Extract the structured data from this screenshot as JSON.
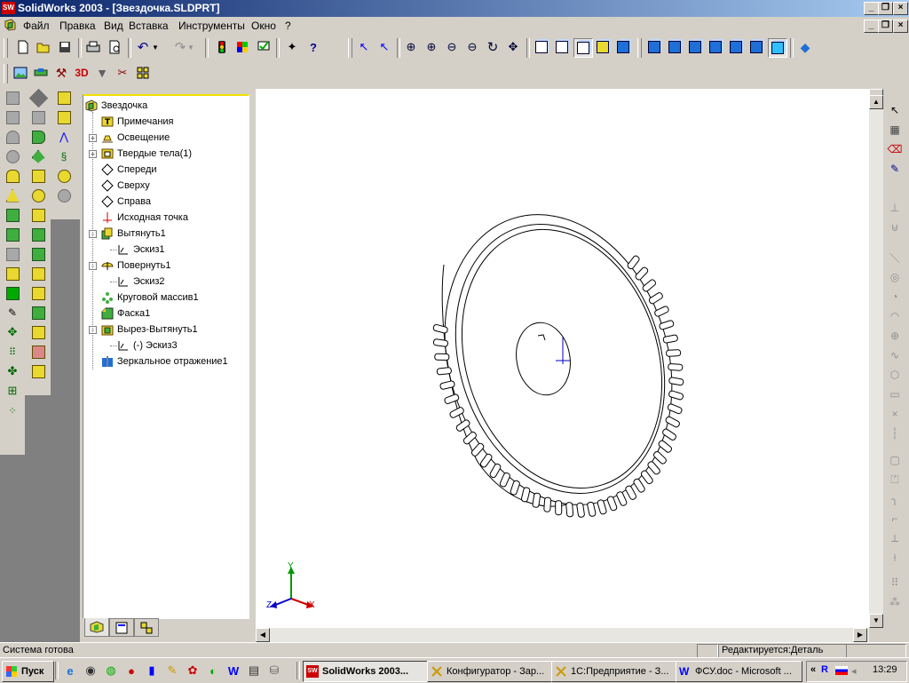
{
  "window": {
    "title": "SolidWorks 2003 - [Звездочка.SLDPRT]",
    "app_icon": "SW"
  },
  "menu": [
    "Файл",
    "Правка",
    "Вид",
    "Вставка",
    "Инструменты",
    "Окно",
    "?"
  ],
  "toolbar": {
    "label_3d": "3D"
  },
  "tree": {
    "root": "Звездочка",
    "items": [
      {
        "label": "Примечания",
        "icon": "annotations-icon"
      },
      {
        "label": "Освещение",
        "icon": "lighting-icon"
      },
      {
        "label": "Твердые тела(1)",
        "icon": "solid-bodies-icon"
      },
      {
        "label": "Спереди",
        "icon": "plane-icon"
      },
      {
        "label": "Сверху",
        "icon": "plane-icon"
      },
      {
        "label": "Справа",
        "icon": "plane-icon"
      },
      {
        "label": "Исходная точка",
        "icon": "origin-icon"
      },
      {
        "label": "Вытянуть1",
        "icon": "extrude-icon"
      },
      {
        "label": "Эскиз1",
        "icon": "sketch-icon"
      },
      {
        "label": "Повернуть1",
        "icon": "revolve-icon"
      },
      {
        "label": "Эскиз2",
        "icon": "sketch-icon"
      },
      {
        "label": "Круговой массив1",
        "icon": "circular-pattern-icon"
      },
      {
        "label": "Фаска1",
        "icon": "chamfer-icon"
      },
      {
        "label": "Вырез-Вытянуть1",
        "icon": "cut-extrude-icon"
      },
      {
        "label": "(-) Эскиз3",
        "icon": "sketch-icon"
      },
      {
        "label": "Зеркальное отражение1",
        "icon": "mirror-icon"
      }
    ]
  },
  "triad": {
    "x": "X",
    "y": "Y",
    "z": "Z"
  },
  "status": {
    "left": "Система готова",
    "right": "Редактируется:Деталь"
  },
  "taskbar": {
    "start": "Пуск",
    "tasks": [
      "SolidWorks 2003...",
      "Конфигуратор - Зар...",
      "1С:Предприятие - З...",
      "ФСУ.doc - Microsoft ..."
    ],
    "tray_chevron": "«",
    "clock": "13:29"
  },
  "colors": {
    "title_start": "#0a246a",
    "title_end": "#a6caf0",
    "chrome": "#d4d0c8",
    "triad_x": "#cc0000",
    "triad_y": "#009900",
    "triad_z": "#0000cc"
  }
}
